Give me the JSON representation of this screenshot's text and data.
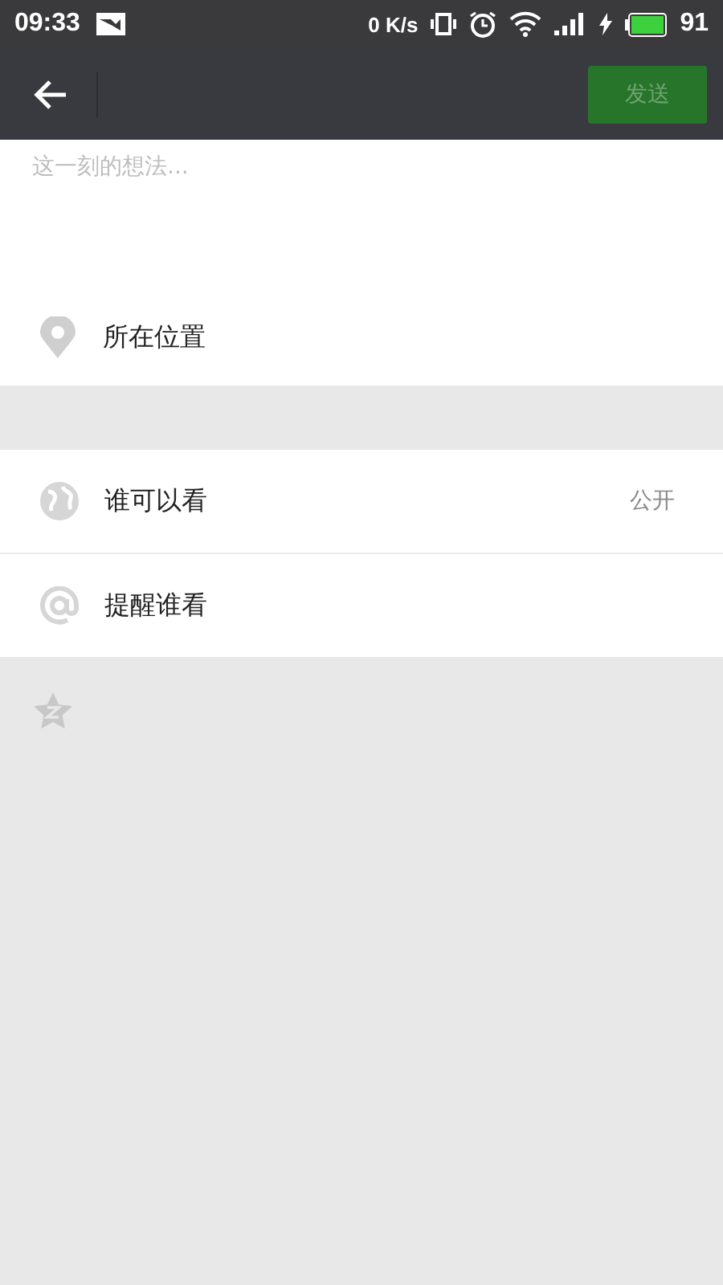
{
  "status_bar": {
    "time": "09:33",
    "net_speed": "0 K/s",
    "battery": "91"
  },
  "header": {
    "send_button": {
      "label": "发送",
      "disabled": true
    }
  },
  "post": {
    "placeholder": "这一刻的想法..."
  },
  "location": {
    "label": "所在位置"
  },
  "options": [
    {
      "kind": "visibility",
      "label": "谁可以看",
      "value": "公开"
    },
    {
      "kind": "mention",
      "label": "提醒谁看"
    }
  ]
}
